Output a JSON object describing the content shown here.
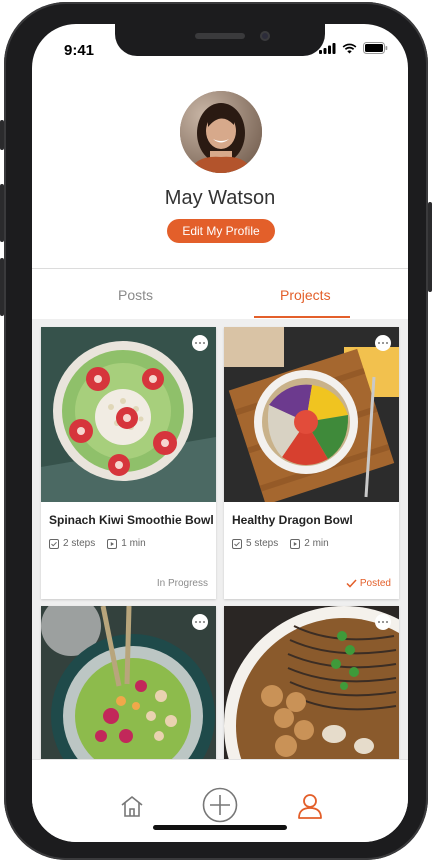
{
  "status_bar": {
    "time": "9:41"
  },
  "profile": {
    "name": "May Watson",
    "edit_label": "Edit My Profile"
  },
  "tabs": [
    {
      "label": "Posts",
      "active": false
    },
    {
      "label": "Projects",
      "active": true
    }
  ],
  "projects": [
    {
      "title": "Spinach Kiwi Smoothie Bowl",
      "steps": "2 steps",
      "duration": "1 min",
      "status": "In Progress",
      "status_color": "#8c8c8c"
    },
    {
      "title": "Healthy Dragon Bowl",
      "steps": "5 steps",
      "duration": "2 min",
      "status": "Posted",
      "status_color": "#e35f2a"
    },
    {
      "title": "",
      "steps": "",
      "duration": "",
      "status": ""
    },
    {
      "title": "",
      "steps": "",
      "duration": "",
      "status": ""
    }
  ],
  "bottom_nav": {
    "items": [
      "home-icon",
      "add-icon",
      "profile-icon"
    ],
    "active": "profile-icon"
  },
  "colors": {
    "accent": "#e35f2a",
    "muted": "#8a8a8a"
  }
}
